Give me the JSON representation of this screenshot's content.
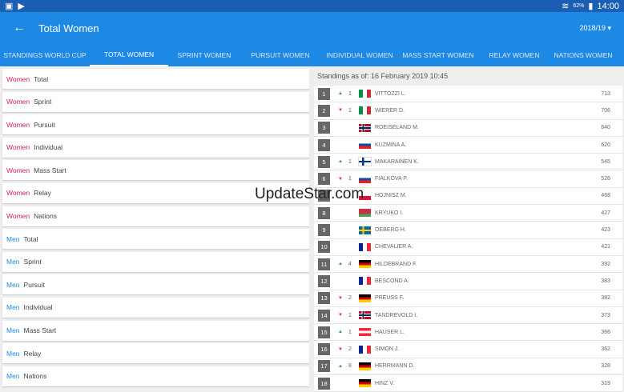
{
  "status": {
    "battery": "62%",
    "time": "14:00"
  },
  "appbar": {
    "title": "Total Women",
    "season": "2018/19 ▾",
    "back_icon": "←"
  },
  "tabs": [
    "STANDINGS WORLD CUP",
    "TOTAL WOMEN",
    "SPRINT WOMEN",
    "PURSUIT WOMEN",
    "INDIVIDUAL WOMEN",
    "MASS START WOMEN",
    "RELAY WOMEN",
    "NATIONS WOMEN"
  ],
  "active_tab": "TOTAL WOMEN",
  "colors": {
    "women": "#d81b60",
    "men": "#1e88e5",
    "appbar": "#1e88e5"
  },
  "menu": [
    {
      "gender": "Women",
      "label": "Total"
    },
    {
      "gender": "Women",
      "label": "Sprint"
    },
    {
      "gender": "Women",
      "label": "Pursuit"
    },
    {
      "gender": "Women",
      "label": "Individual"
    },
    {
      "gender": "Women",
      "label": "Mass Start"
    },
    {
      "gender": "Women",
      "label": "Relay"
    },
    {
      "gender": "Women",
      "label": "Nations"
    },
    {
      "gender": "Men",
      "label": "Total"
    },
    {
      "gender": "Men",
      "label": "Sprint"
    },
    {
      "gender": "Men",
      "label": "Pursuit"
    },
    {
      "gender": "Men",
      "label": "Individual"
    },
    {
      "gender": "Men",
      "label": "Mass Start"
    },
    {
      "gender": "Men",
      "label": "Relay"
    },
    {
      "gender": "Men",
      "label": "Nations"
    }
  ],
  "standings_header": "Standings as of: 16 February 2019 10:45",
  "standings": [
    {
      "rank": "1",
      "dir": "up",
      "chg": "1",
      "nat": "ITA",
      "name": "VITTOZZI L.",
      "pts": "713"
    },
    {
      "rank": "2",
      "dir": "down",
      "chg": "1",
      "nat": "ITA",
      "name": "WIERER D.",
      "pts": "706"
    },
    {
      "rank": "3",
      "dir": "",
      "chg": "",
      "nat": "NOR",
      "name": "ROEISELAND M.",
      "pts": "640"
    },
    {
      "rank": "4",
      "dir": "",
      "chg": "",
      "nat": "SVK",
      "name": "KUZMINA A.",
      "pts": "620"
    },
    {
      "rank": "5",
      "dir": "up",
      "chg": "1",
      "nat": "FIN",
      "name": "MAKARAINEN K.",
      "pts": "545"
    },
    {
      "rank": "6",
      "dir": "down",
      "chg": "1",
      "nat": "SVK",
      "name": "FIALKOVA P.",
      "pts": "526"
    },
    {
      "rank": "7",
      "dir": "",
      "chg": "",
      "nat": "POL",
      "name": "HOJNISZ M.",
      "pts": "468"
    },
    {
      "rank": "8",
      "dir": "",
      "chg": "",
      "nat": "BLR",
      "name": "KRYUKO I.",
      "pts": "427"
    },
    {
      "rank": "9",
      "dir": "",
      "chg": "",
      "nat": "SWE",
      "name": "OEBERG H.",
      "pts": "423"
    },
    {
      "rank": "10",
      "dir": "",
      "chg": "",
      "nat": "FRA",
      "name": "CHEVALIER A.",
      "pts": "421"
    },
    {
      "rank": "11",
      "dir": "up",
      "chg": "4",
      "nat": "GER",
      "name": "HILDEBRAND F.",
      "pts": "392"
    },
    {
      "rank": "12",
      "dir": "",
      "chg": "",
      "nat": "FRA",
      "name": "BESCOND A.",
      "pts": "383"
    },
    {
      "rank": "13",
      "dir": "down",
      "chg": "2",
      "nat": "GER",
      "name": "PREUSS F.",
      "pts": "382"
    },
    {
      "rank": "14",
      "dir": "down",
      "chg": "1",
      "nat": "NOR",
      "name": "TANDREVOLD I.",
      "pts": "373"
    },
    {
      "rank": "15",
      "dir": "up",
      "chg": "1",
      "nat": "AUT",
      "name": "HAUSER L.",
      "pts": "366"
    },
    {
      "rank": "16",
      "dir": "down",
      "chg": "2",
      "nat": "FRA",
      "name": "SIMON J.",
      "pts": "362"
    },
    {
      "rank": "17",
      "dir": "up",
      "chg": "8",
      "nat": "GER",
      "name": "HERRMANN D.",
      "pts": "328"
    },
    {
      "rank": "18",
      "dir": "",
      "chg": "",
      "nat": "GER",
      "name": "HINZ V.",
      "pts": "319"
    }
  ],
  "watermark": "UpdateStar.com"
}
